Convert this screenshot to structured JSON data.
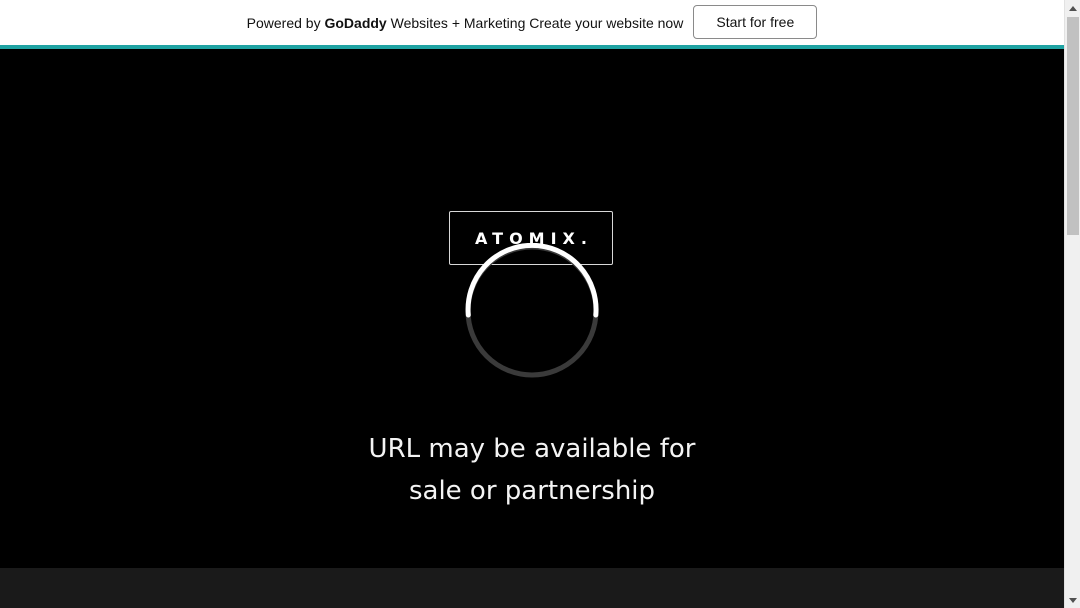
{
  "banner": {
    "prefix": "Powered by ",
    "brand": "GoDaddy",
    "suffix": " Websites + Marketing Create your website now",
    "cta_label": "Start for free",
    "accent_color": "#1fa3a3"
  },
  "logo": {
    "text": "ATOMIX."
  },
  "spinner": {
    "icon": "loading-spinner-icon"
  },
  "headline": {
    "line1": "URL may be available for",
    "line2": "sale or partnership"
  },
  "scrollbar": {
    "up_icon": "arrow-up-icon",
    "down_icon": "arrow-down-icon"
  }
}
